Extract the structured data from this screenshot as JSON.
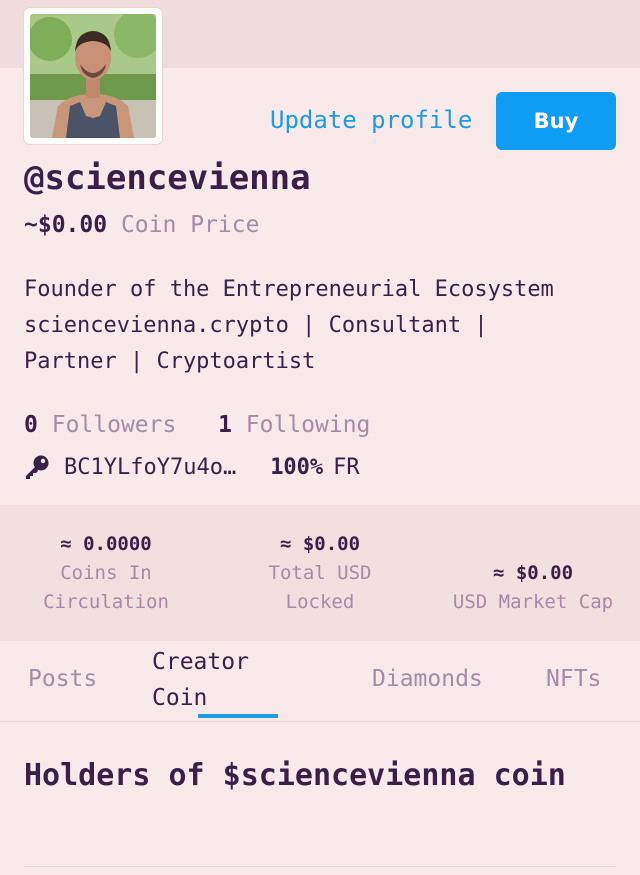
{
  "profile": {
    "update_label": "Update profile",
    "buy_label": "Buy",
    "username": "@sciencevienna",
    "coin_price_value": "~$0.00",
    "coin_price_label": "Coin Price",
    "bio_lines": [
      "Founder of the Entrepreneurial Ecosystem",
      "sciencevienna.crypto | Consultant |",
      "Partner | Cryptoartist"
    ],
    "followers_count": "0",
    "followers_label": "Followers",
    "following_count": "1",
    "following_label": "Following",
    "public_key": "BC1YLfoY7u4o…",
    "founder_reward_pct": "100%",
    "founder_reward_label": "FR"
  },
  "stats": {
    "coins_value": "≈ 0.0000",
    "coins_label_1": "Coins In",
    "coins_label_2": "Circulation",
    "locked_value": "≈ $0.00",
    "locked_label_1": "Total USD",
    "locked_label_2": "Locked",
    "mcap_value": "≈ $0.00",
    "mcap_label": "USD Market Cap"
  },
  "tabs": {
    "posts": "Posts",
    "creator_coin_1": "Creator",
    "creator_coin_2": "Coin",
    "diamonds": "Diamonds",
    "nfts": "NFTs"
  },
  "holders": {
    "title": "Holders of $sciencevienna coin"
  },
  "colors": {
    "accent_blue": "#0f9cf5",
    "text_dark": "#3b1f47",
    "text_muted": "#a88aa8",
    "background": "#f8eaea"
  }
}
